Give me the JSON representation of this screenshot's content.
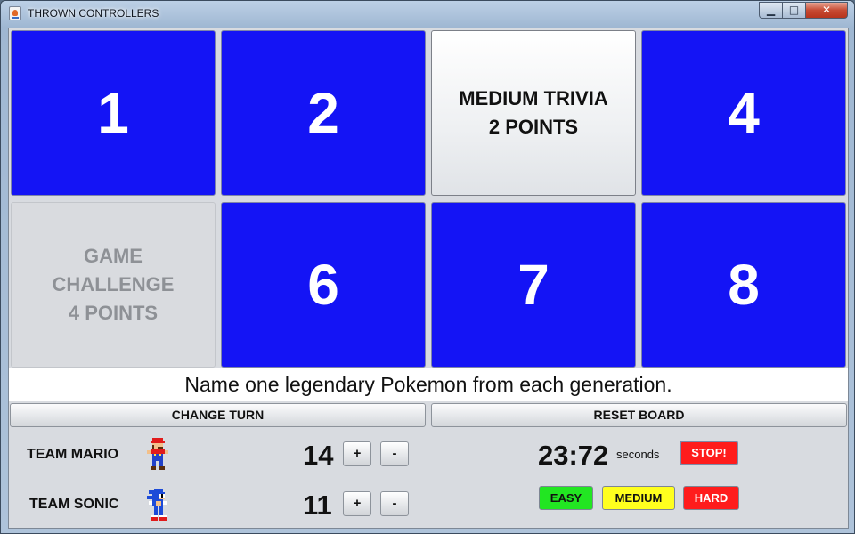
{
  "window": {
    "title": "THROWN CONTROLLERS",
    "minimize_glyph": "▁",
    "maximize_glyph": "□",
    "close_glyph": "✕"
  },
  "board": {
    "tiles": [
      {
        "label": "1",
        "state": "hidden"
      },
      {
        "label": "2",
        "state": "hidden"
      },
      {
        "label": "MEDIUM TRIVIA\n2 POINTS",
        "state": "revealed"
      },
      {
        "label": "4",
        "state": "hidden"
      },
      {
        "label": "GAME\nCHALLENGE\n4 POINTS",
        "state": "used"
      },
      {
        "label": "6",
        "state": "hidden"
      },
      {
        "label": "7",
        "state": "hidden"
      },
      {
        "label": "8",
        "state": "hidden"
      }
    ],
    "tile_color": "#1414f5"
  },
  "question": "Name one legendary Pokemon from each generation.",
  "controls": {
    "change_turn": "CHANGE TURN",
    "reset_board": "RESET BOARD"
  },
  "teams": [
    {
      "name": "TEAM MARIO",
      "score": "14",
      "icon": "mario-sprite-icon",
      "plus": "+",
      "minus": "-"
    },
    {
      "name": "TEAM SONIC",
      "score": "11",
      "icon": "sonic-sprite-icon",
      "plus": "+",
      "minus": "-"
    }
  ],
  "timer": {
    "value": "23:72",
    "unit": "seconds",
    "stop_label": "STOP!"
  },
  "difficulty": {
    "easy": "EASY",
    "medium": "MEDIUM",
    "hard": "HARD",
    "colors": {
      "easy": "#22e622",
      "medium": "#ffff1e",
      "hard": "#ff1c1c"
    }
  }
}
